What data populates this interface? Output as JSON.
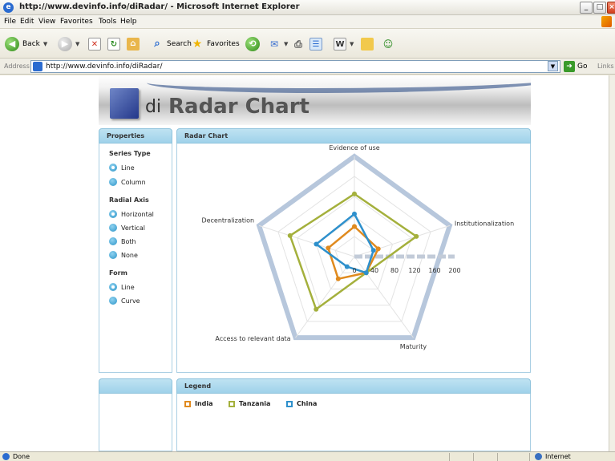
{
  "window": {
    "title": "http://www.devinfo.info/diRadar/ - Microsoft Internet Explorer",
    "min_icon": "minimize-icon",
    "max_icon": "maximize-icon",
    "close_icon": "close-icon"
  },
  "menu": [
    "File",
    "Edit",
    "View",
    "Favorites",
    "Tools",
    "Help"
  ],
  "toolbar": {
    "back_label": "Back",
    "search_label": "Search",
    "favorites_label": "Favorites"
  },
  "address": {
    "label": "Address",
    "url": "http://www.devinfo.info/diRadar/",
    "go_label": "Go",
    "links_label": "Links"
  },
  "banner": {
    "prefix": "di",
    "title": "Radar Chart"
  },
  "properties": {
    "header": "Properties",
    "series_type": {
      "heading": "Series Type",
      "options": [
        "Line",
        "Column"
      ],
      "selected": "Line"
    },
    "radial_axis": {
      "heading": "Radial Axis",
      "options": [
        "Horizontal",
        "Vertical",
        "Both",
        "None"
      ],
      "selected": "Horizontal"
    },
    "form": {
      "heading": "Form",
      "options": [
        "Line",
        "Curve"
      ],
      "selected": "Line"
    }
  },
  "chart_panel": {
    "header": "Radar Chart"
  },
  "legend_panel": {
    "header": "Legend"
  },
  "chart_data": {
    "type": "radar",
    "axes": [
      "Evidence of use",
      "Institutionalization",
      "Maturity",
      "Access to relevant data",
      "Decentralization"
    ],
    "radial_ticks": [
      "0",
      "40",
      "80",
      "120",
      "160",
      "200"
    ],
    "rmax": 200,
    "radial_axis": "horizontal",
    "series": [
      {
        "name": "India",
        "color": "#e08a1e",
        "values": [
          60,
          50,
          40,
          55,
          55
        ]
      },
      {
        "name": "Tanzania",
        "color": "#a4b03c",
        "values": [
          125,
          130,
          40,
          130,
          135
        ]
      },
      {
        "name": "China",
        "color": "#2e90cc",
        "values": [
          85,
          40,
          40,
          25,
          80
        ]
      }
    ]
  },
  "status": {
    "text": "Done",
    "zone": "Internet"
  }
}
